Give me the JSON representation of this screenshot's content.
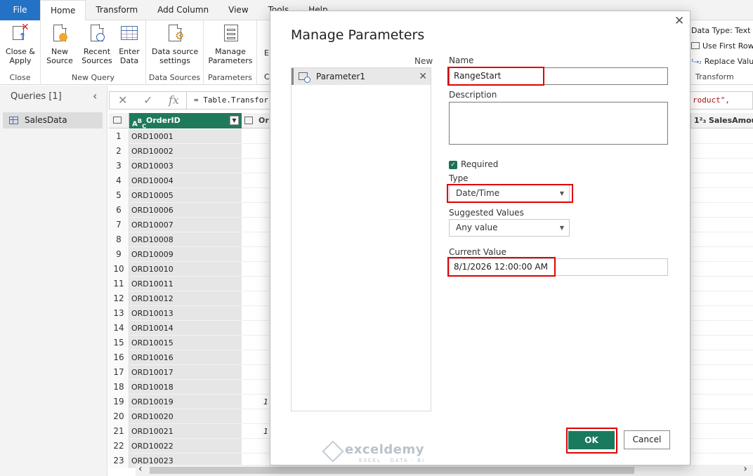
{
  "ribbon_tabs": [
    "File",
    "Home",
    "Transform",
    "Add Column",
    "View",
    "Tools",
    "Help"
  ],
  "ribbon": {
    "close_apply": "Close &\nApply",
    "close_group": "Close",
    "new_source": "New\nSource",
    "recent_sources": "Recent\nSources",
    "enter_data": "Enter\nData",
    "new_query_group": "New Query",
    "data_source_settings": "Data source\nsettings",
    "data_sources_group": "Data Sources",
    "manage_parameters": "Manage\nParameters",
    "parameters_group": "Parameters",
    "cut_e": "E",
    "cut_c": "C",
    "data_type": "Data Type: Text",
    "use_first_row": "Use First Row",
    "replace_values": "Replace Value",
    "transform_group": "Transform"
  },
  "queries": {
    "header": "Queries [1]",
    "items": [
      "SalesData"
    ]
  },
  "formula": {
    "text": "= Table.Transfor",
    "text_right": "roduct\","
  },
  "grid": {
    "col_order": "OrderID",
    "col_ord2": "Or",
    "col_sales": "SalesAmount",
    "rows": [
      {
        "n": "1",
        "id": "ORD10001",
        "c2": ""
      },
      {
        "n": "2",
        "id": "ORD10002",
        "c2": ""
      },
      {
        "n": "3",
        "id": "ORD10003",
        "c2": ""
      },
      {
        "n": "4",
        "id": "ORD10004",
        "c2": ""
      },
      {
        "n": "5",
        "id": "ORD10005",
        "c2": ""
      },
      {
        "n": "6",
        "id": "ORD10006",
        "c2": ""
      },
      {
        "n": "7",
        "id": "ORD10007",
        "c2": ""
      },
      {
        "n": "8",
        "id": "ORD10008",
        "c2": ""
      },
      {
        "n": "9",
        "id": "ORD10009",
        "c2": ""
      },
      {
        "n": "10",
        "id": "ORD10010",
        "c2": ""
      },
      {
        "n": "11",
        "id": "ORD10011",
        "c2": ""
      },
      {
        "n": "12",
        "id": "ORD10012",
        "c2": ""
      },
      {
        "n": "13",
        "id": "ORD10013",
        "c2": ""
      },
      {
        "n": "14",
        "id": "ORD10014",
        "c2": ""
      },
      {
        "n": "15",
        "id": "ORD10015",
        "c2": ""
      },
      {
        "n": "16",
        "id": "ORD10016",
        "c2": ""
      },
      {
        "n": "17",
        "id": "ORD10017",
        "c2": ""
      },
      {
        "n": "18",
        "id": "ORD10018",
        "c2": ""
      },
      {
        "n": "19",
        "id": "ORD10019",
        "c2": "1"
      },
      {
        "n": "20",
        "id": "ORD10020",
        "c2": ""
      },
      {
        "n": "21",
        "id": "ORD10021",
        "c2": "1"
      },
      {
        "n": "22",
        "id": "ORD10022",
        "c2": ""
      },
      {
        "n": "23",
        "id": "ORD10023",
        "c2": ""
      }
    ]
  },
  "dialog": {
    "title": "Manage Parameters",
    "new_label": "New",
    "parameters": [
      "Parameter1"
    ],
    "name_label": "Name",
    "name_value": "RangeStart",
    "description_label": "Description",
    "description_value": "",
    "required_label": "Required",
    "type_label": "Type",
    "type_value": "Date/Time",
    "suggested_label": "Suggested Values",
    "suggested_value": "Any value",
    "current_label": "Current Value",
    "current_value": "8/1/2026 12:00:00 AM",
    "ok_label": "OK",
    "cancel_label": "Cancel",
    "highlight_color": "#e00000",
    "accent_color": "#1a7a5e"
  },
  "watermark": {
    "name": "exceldemy",
    "tagline": "EXCEL · DATA · BI"
  }
}
